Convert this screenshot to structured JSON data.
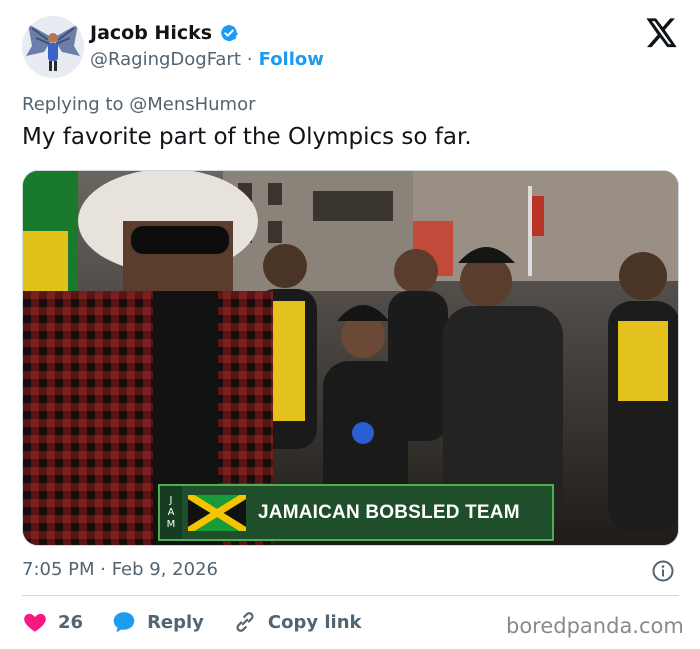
{
  "author": {
    "display_name": "Jacob Hicks",
    "handle": "@RagingDogFart",
    "separator": "·",
    "follow_label": "Follow",
    "verified_color": "#1d9bf0"
  },
  "reply": {
    "prefix": "Replying to",
    "to_handle": "@MensHumor"
  },
  "tweet": {
    "text": "My favorite part of the Olympics so far."
  },
  "media": {
    "lower_third_code": "JAM",
    "lower_third_text": "JAMAICAN BOBSLED TEAM",
    "lower_third_bg": "#1f4e2a",
    "lower_third_border": "#4caf50"
  },
  "meta": {
    "timestamp": "7:05 PM · Feb 9, 2026"
  },
  "actions": {
    "like_count": "26",
    "reply_label": "Reply",
    "copy_label": "Copy link",
    "like_color": "#f91880",
    "reply_color": "#1d9bf0"
  },
  "icons": [
    "verified-badge-icon",
    "x-logo-icon",
    "info-icon",
    "heart-icon",
    "reply-bubble-icon",
    "link-icon"
  ],
  "watermark": "boredpanda.com"
}
